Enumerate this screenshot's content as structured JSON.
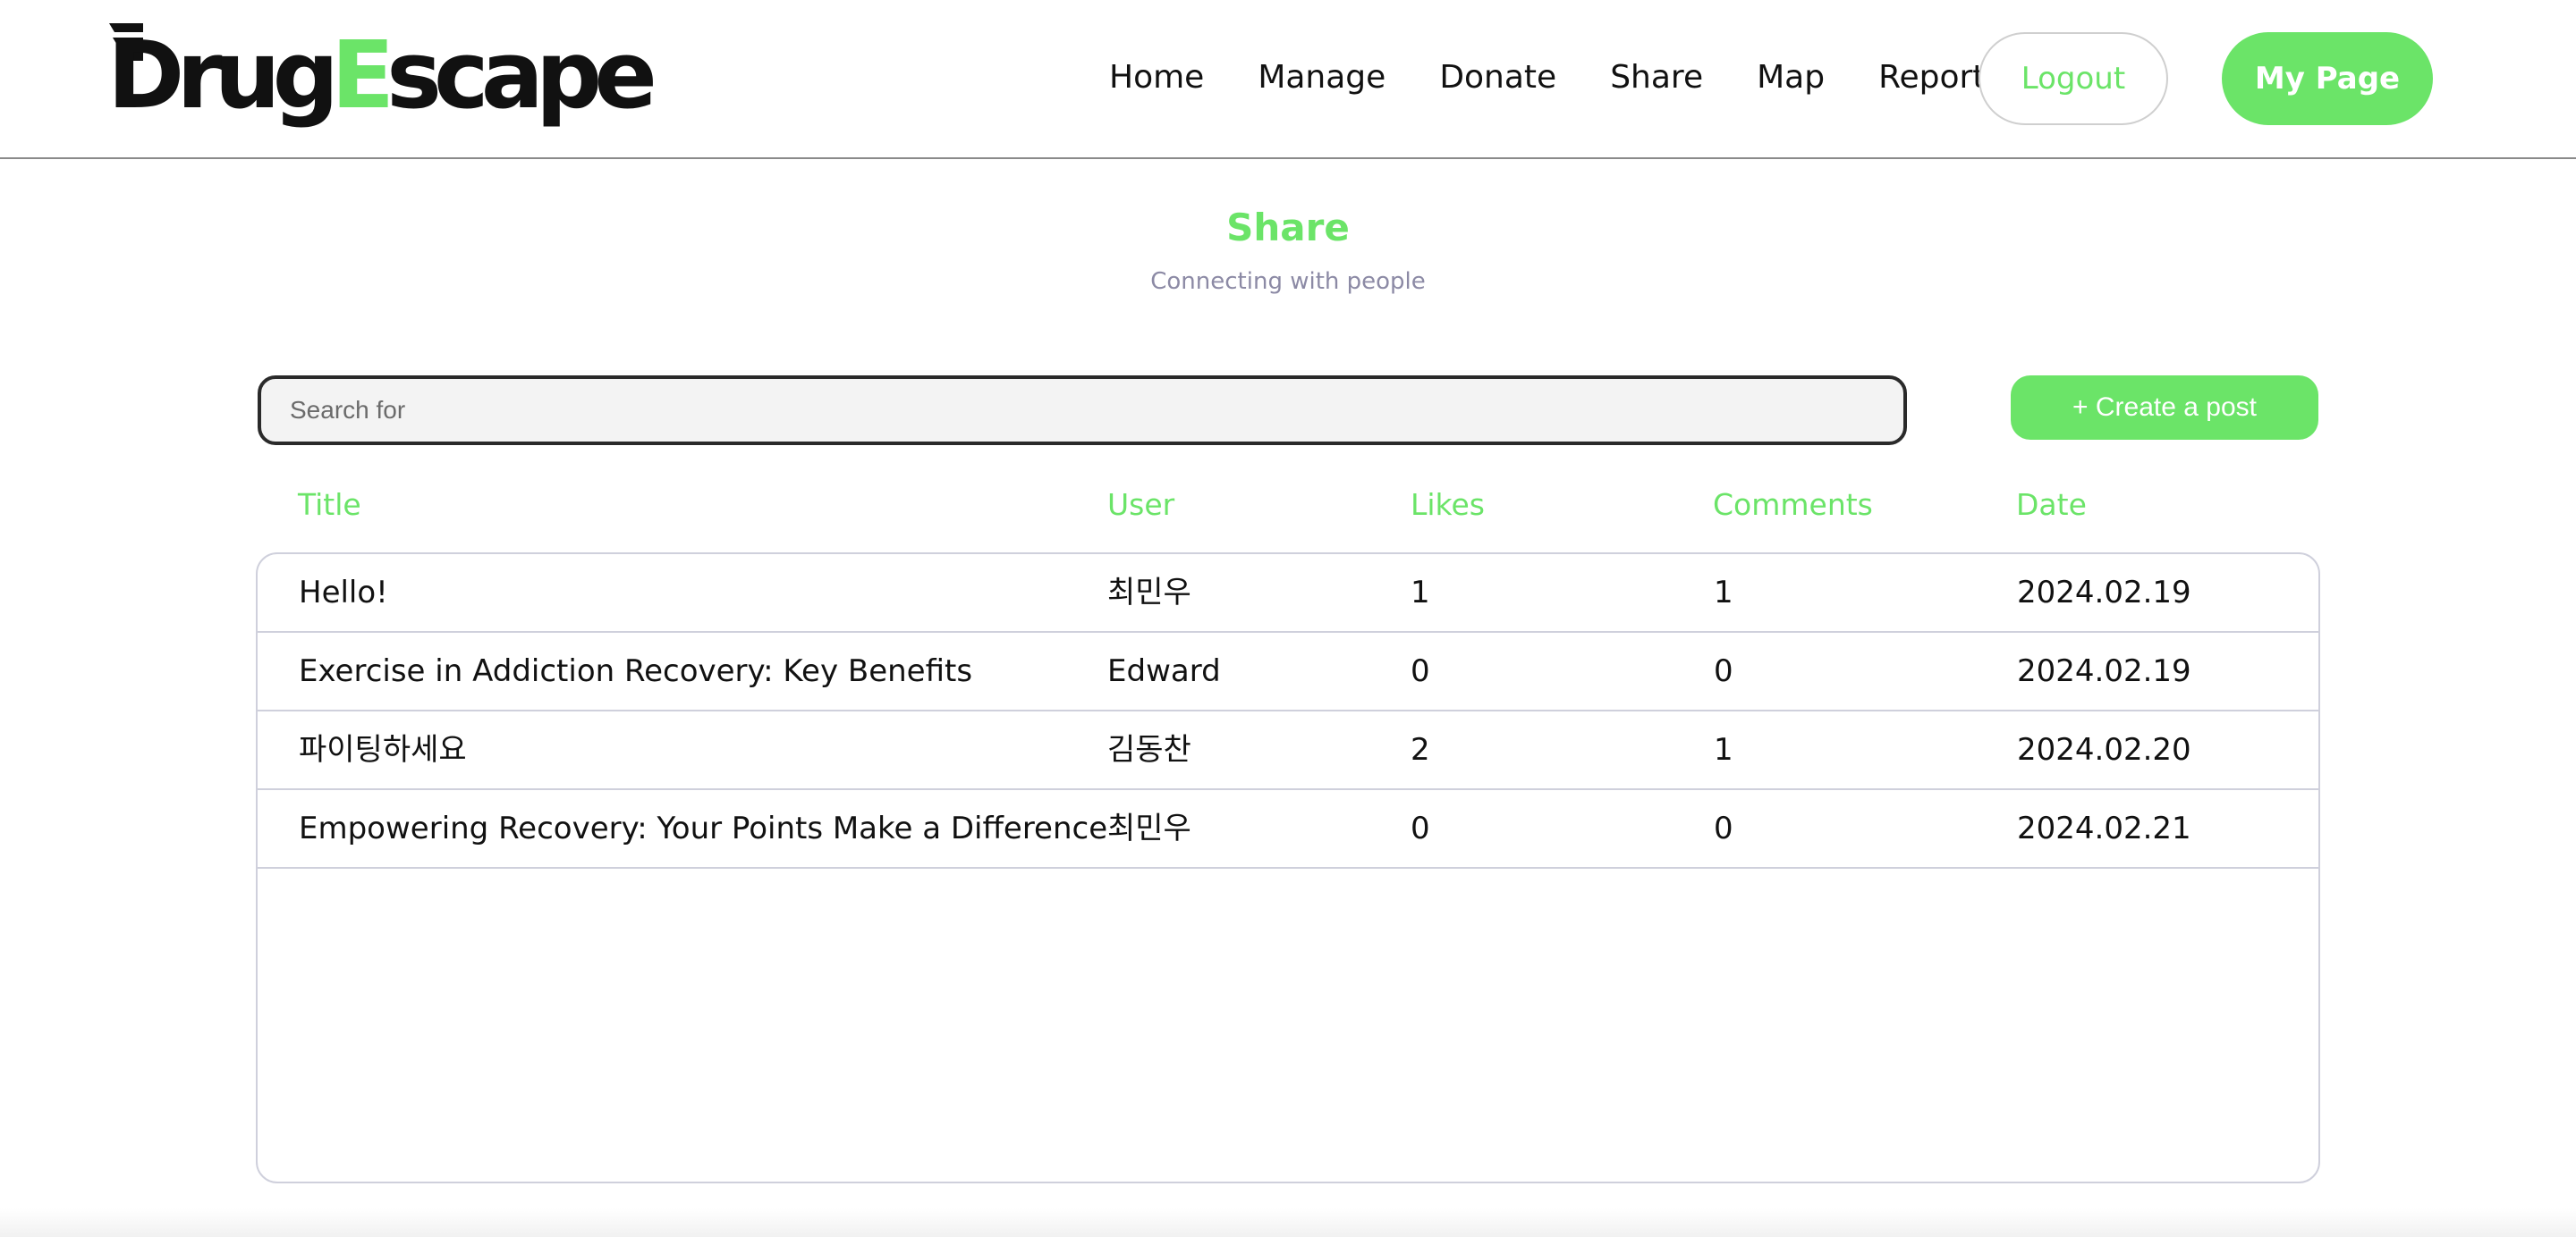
{
  "brand": {
    "logo_part1": "Drug",
    "logo_accent": "E",
    "logo_part2": "scape",
    "accent_color": "#6be468"
  },
  "nav": {
    "items": [
      {
        "label": "Home"
      },
      {
        "label": "Manage"
      },
      {
        "label": "Donate"
      },
      {
        "label": "Share"
      },
      {
        "label": "Map"
      },
      {
        "label": "Report"
      }
    ],
    "logout_label": "Logout",
    "mypage_label": "My Page"
  },
  "page": {
    "title": "Share",
    "subtitle": "Connecting with people"
  },
  "search": {
    "placeholder": "Search for",
    "value": ""
  },
  "create_button": {
    "label": "+ Create a post"
  },
  "table": {
    "columns": {
      "title": "Title",
      "user": "User",
      "likes": "Likes",
      "comments": "Comments",
      "date": "Date"
    },
    "rows": [
      {
        "title": "Hello!",
        "user": "최민우",
        "likes": "1",
        "comments": "1",
        "date": "2024.02.19"
      },
      {
        "title": "Exercise in Addiction Recovery: Key Benefits",
        "user": "Edward",
        "likes": "0",
        "comments": "0",
        "date": "2024.02.19"
      },
      {
        "title": "파이팅하세요",
        "user": "김동찬",
        "likes": "2",
        "comments": "1",
        "date": "2024.02.20"
      },
      {
        "title": "Empowering Recovery: Your Points Make a Difference",
        "user": "최민우",
        "likes": "0",
        "comments": "0",
        "date": "2024.02.21"
      }
    ]
  }
}
